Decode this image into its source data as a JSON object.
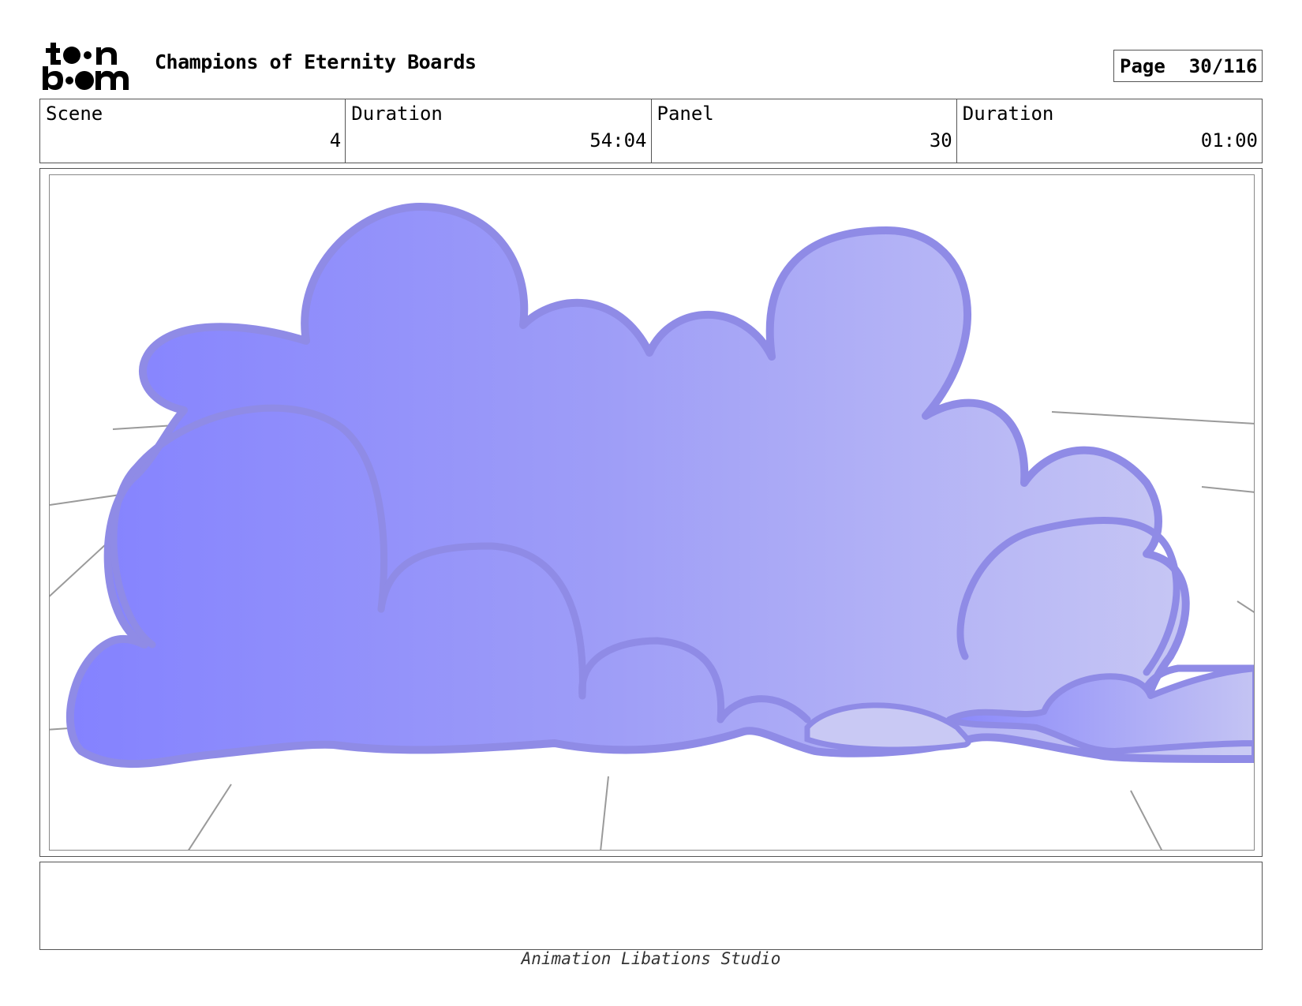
{
  "header": {
    "logo_text": "toon boom",
    "title": "Champions of Eternity Boards",
    "page_label": "Page",
    "page_value": "30/116"
  },
  "info": {
    "scene_label": "Scene",
    "scene_value": "4",
    "scene_duration_label": "Duration",
    "scene_duration_value": "54:04",
    "panel_label": "Panel",
    "panel_value": "30",
    "panel_duration_label": "Duration",
    "panel_duration_value": "01:00"
  },
  "panel_image": {
    "subject": "purple cloud bank",
    "colors": {
      "cloud_dark": "#8482ff",
      "cloud_light": "#c8c8f4",
      "outline": "#8f8be6",
      "perspective_lines": "#9a9a9a"
    }
  },
  "notes": {
    "text": ""
  },
  "footer": {
    "studio": "Animation Libations Studio"
  }
}
